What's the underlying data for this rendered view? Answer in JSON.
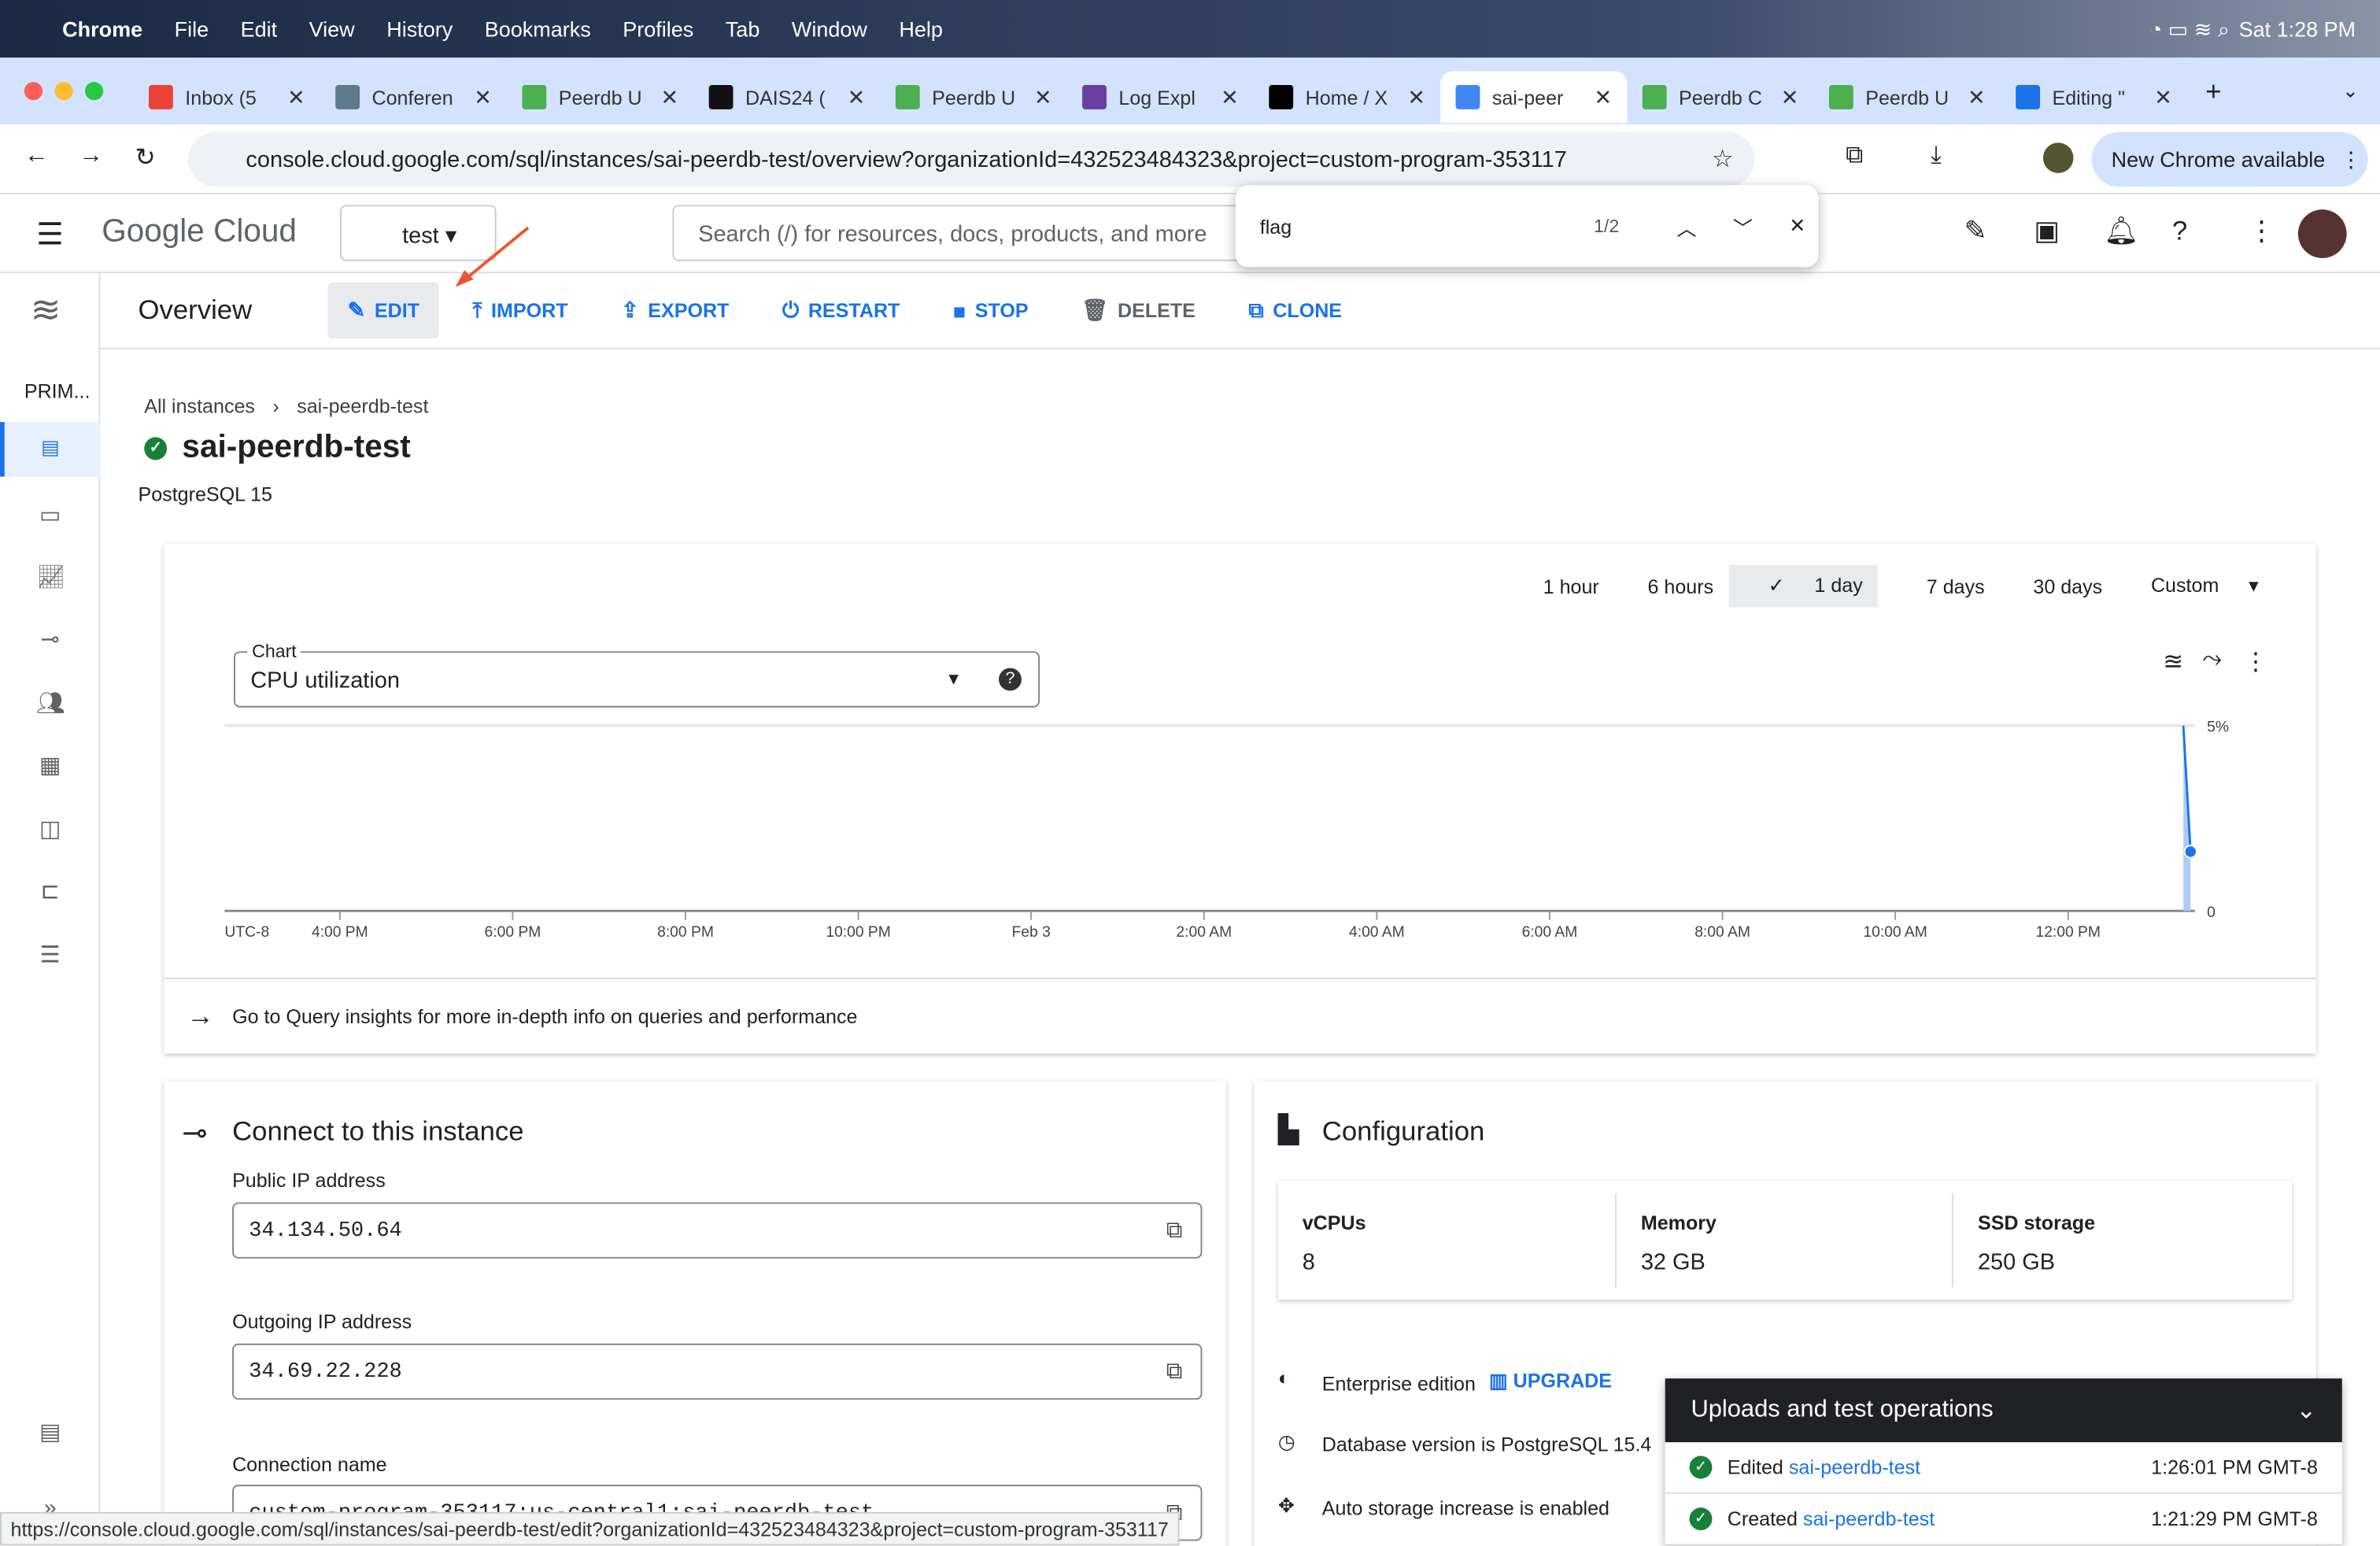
{
  "menubar": {
    "apple": "",
    "app": "Chrome",
    "items": [
      "File",
      "Edit",
      "View",
      "History",
      "Bookmarks",
      "Profiles",
      "Tab",
      "Window",
      "Help"
    ],
    "clock": "Sat 1:28 PM"
  },
  "tabs": [
    {
      "label": "Inbox (5",
      "color": "#ea4335"
    },
    {
      "label": "Conferen",
      "color": "#5f7b8a"
    },
    {
      "label": "Peerdb U",
      "color": "#4caf50"
    },
    {
      "label": "DAIS24 (",
      "color": "#111111"
    },
    {
      "label": "Peerdb U",
      "color": "#4caf50"
    },
    {
      "label": "Log Expl",
      "color": "#6a3fa0"
    },
    {
      "label": "Home / X",
      "color": "#000000"
    },
    {
      "label": "sai-peer",
      "color": "#4285f4",
      "active": true
    },
    {
      "label": "Peerdb C",
      "color": "#4caf50"
    },
    {
      "label": "Peerdb U",
      "color": "#4caf50"
    },
    {
      "label": "Editing \"",
      "color": "#1a73e8"
    }
  ],
  "address": {
    "url": "console.cloud.google.com/sql/instances/sai-peerdb-test/overview?organizationId=432523484323&project=custom-program-353117",
    "new_chrome": "New Chrome available"
  },
  "gc": {
    "logo": "Google Cloud",
    "project": "test",
    "search_placeholder": "Search (/) for resources, docs, products, and more"
  },
  "find": {
    "query": "flag",
    "count": "1/2"
  },
  "toolbar": {
    "title": "Overview",
    "buttons": [
      {
        "label": "EDIT",
        "icon": "pencil"
      },
      {
        "label": "IMPORT",
        "icon": "upload"
      },
      {
        "label": "EXPORT",
        "icon": "export"
      },
      {
        "label": "RESTART",
        "icon": "power"
      },
      {
        "label": "STOP",
        "icon": "stop"
      },
      {
        "label": "DELETE",
        "icon": "trash"
      },
      {
        "label": "CLONE",
        "icon": "clone"
      }
    ]
  },
  "rail": {
    "label": "PRIM..."
  },
  "breadcrumb": {
    "root": "All instances",
    "current": "sai-peerdb-test"
  },
  "instance": {
    "name": "sai-peerdb-test",
    "version": "PostgreSQL 15",
    "status": "running"
  },
  "ranges": {
    "options": [
      "1 hour",
      "6 hours",
      "1 day",
      "7 days",
      "30 days",
      "Custom"
    ],
    "selected": "1 day"
  },
  "chart_select": {
    "label": "Chart",
    "value": "CPU utilization"
  },
  "chart_data": {
    "type": "area",
    "title": "",
    "x_ticks": [
      "UTC-8",
      "4:00 PM",
      "6:00 PM",
      "8:00 PM",
      "10:00 PM",
      "Feb 3",
      "2:00 AM",
      "4:00 AM",
      "6:00 AM",
      "8:00 AM",
      "10:00 AM",
      "12:00 PM"
    ],
    "y_ticks": [
      "0",
      "5%"
    ],
    "ylim": [
      0,
      5
    ],
    "xlim": [
      "2:40 PM",
      "1:28 PM"
    ],
    "series": [
      {
        "x": [
          "1:20 PM",
          "1:25 PM"
        ],
        "y": [
          5,
          1.6
        ]
      }
    ],
    "color": "#1a73e8"
  },
  "insights_link": "Go to Query insights for more in-depth info on queries and performance",
  "connect": {
    "title": "Connect to this instance",
    "public_label": "Public IP address",
    "public_ip": "34.134.50.64",
    "outgoing_label": "Outgoing IP address",
    "outgoing_ip": "34.69.22.228",
    "conn_label": "Connection name",
    "conn_value": "custom-program-353117:us-central1:sai-peerdb-test"
  },
  "config": {
    "title": "Configuration",
    "items": [
      {
        "label": "vCPUs",
        "value": "8"
      },
      {
        "label": "Memory",
        "value": "32 GB"
      },
      {
        "label": "SSD storage",
        "value": "250 GB"
      }
    ],
    "edition": "Enterprise edition",
    "upgrade": "UPGRADE",
    "db_version": "Database version is PostgreSQL 15.4",
    "storage": "Auto storage increase is enabled"
  },
  "ops": {
    "title": "Uploads and test operations",
    "rows": [
      {
        "action": "Edited",
        "target": "sai-peerdb-test",
        "time": "1:26:01 PM GMT-8"
      },
      {
        "action": "Created",
        "target": "sai-peerdb-test",
        "time": "1:21:29 PM GMT-8"
      }
    ]
  },
  "status_url": "https://console.cloud.google.com/sql/instances/sai-peerdb-test/edit?organizationId=432523484323&project=custom-program-353117"
}
